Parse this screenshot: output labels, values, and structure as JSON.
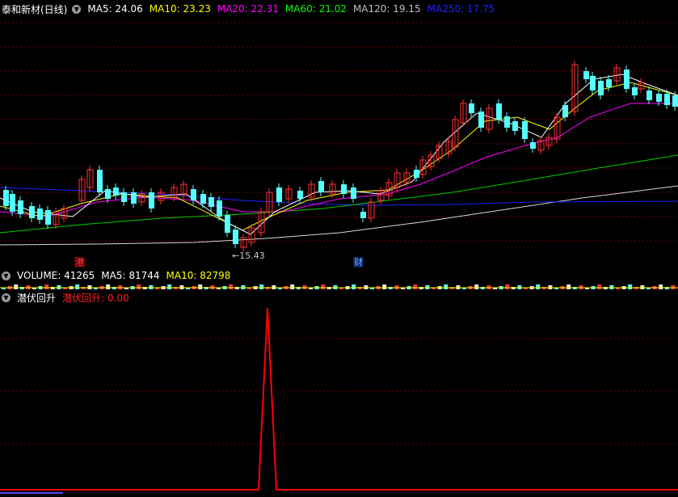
{
  "main": {
    "stock_name": "泰和新材(日线)",
    "ma_labels": [
      {
        "text": "MA5: 24.06",
        "color": "#ffffff"
      },
      {
        "text": "MA10: 23.23",
        "color": "#ffff00"
      },
      {
        "text": "MA20: 22.31",
        "color": "#ff00ff"
      },
      {
        "text": "MA60: 21.02",
        "color": "#00ff00"
      },
      {
        "text": "MA120: 19.15",
        "color": "#c0c0c0"
      },
      {
        "text": "MA250: 17.75",
        "color": "#0000ff"
      }
    ],
    "low_label": "15.43",
    "markers": [
      {
        "text": "港",
        "color": "#ff4040",
        "bg": "#5a0000"
      },
      {
        "text": "财",
        "color": "#80b0ff",
        "bg": "#00205a"
      }
    ]
  },
  "volume": {
    "title": "VOLUME: 41265",
    "ma5": "MA5: 81744",
    "ma10": "MA10: 82798"
  },
  "indicator": {
    "title": "潜伏回升",
    "value_label": "潜伏回升: 0.00"
  },
  "colors": {
    "bg": "#000000",
    "grid": "#7a0000",
    "up": "#ff3030",
    "down": "#54ffff",
    "signal": "#ff0000"
  }
}
